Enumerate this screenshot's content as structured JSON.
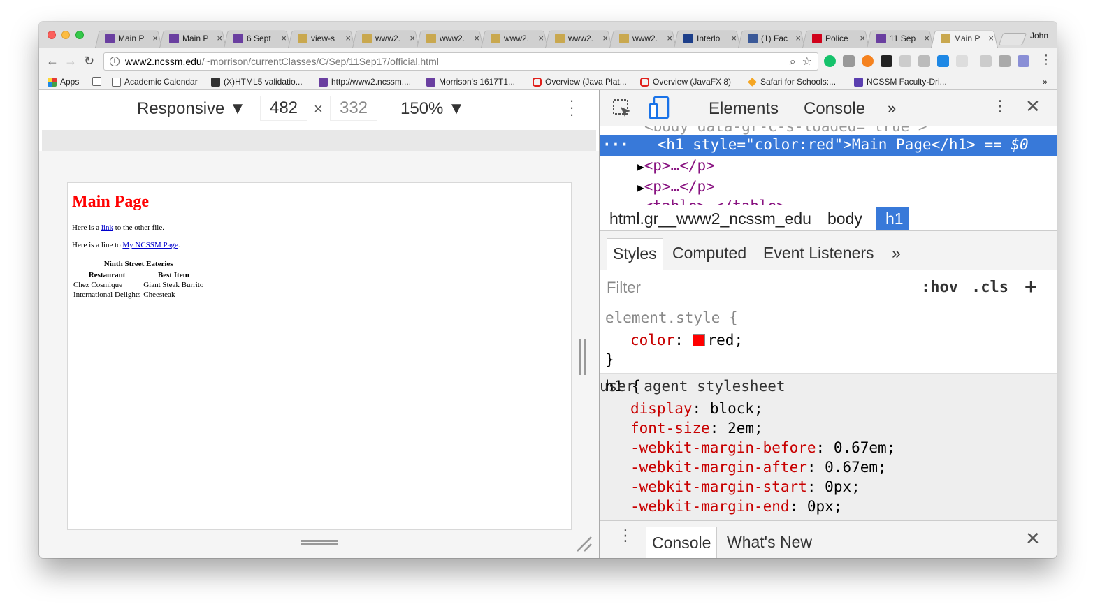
{
  "browser": {
    "tabs": [
      {
        "title": "Main P",
        "fav": "#6a3fa0",
        "active": false
      },
      {
        "title": "Main P",
        "fav": "#6a3fa0",
        "active": false
      },
      {
        "title": "6 Sept",
        "fav": "#6a3fa0",
        "active": false
      },
      {
        "title": "view-s",
        "fav": "#c9a84f",
        "active": false
      },
      {
        "title": "www2.",
        "fav": "#c9a84f",
        "active": false
      },
      {
        "title": "www2.",
        "fav": "#c9a84f",
        "active": false
      },
      {
        "title": "www2.",
        "fav": "#c9a84f",
        "active": false
      },
      {
        "title": "www2.",
        "fav": "#c9a84f",
        "active": false
      },
      {
        "title": "www2.",
        "fav": "#c9a84f",
        "active": false
      },
      {
        "title": "Interlo",
        "fav": "#1d3f8a",
        "active": false
      },
      {
        "title": "(1) Fac",
        "fav": "#3b5998",
        "active": false
      },
      {
        "title": "Police",
        "fav": "#d0021b",
        "active": false
      },
      {
        "title": "11 Sep",
        "fav": "#6a3fa0",
        "active": false
      },
      {
        "title": "Main P",
        "fav": "#c9a84f",
        "active": true
      }
    ],
    "profile_name": "John",
    "url_host": "www2.ncssm.edu",
    "url_path": "/~morrison/currentClasses/C/Sep/11Sep17/official.html",
    "bookmarks": [
      {
        "label": "Apps",
        "icon": "apps-grid-icon"
      },
      {
        "label": "",
        "icon": "page-icon"
      },
      {
        "label": "Academic Calendar",
        "icon": "page-icon"
      },
      {
        "label": "(X)HTML5 validatio...",
        "icon": "validator-icon"
      },
      {
        "label": "http://www2.ncssm....",
        "icon": "ncssm-icon"
      },
      {
        "label": "Morrison's 1617T1...",
        "icon": "ncssm-icon"
      },
      {
        "label": "Overview (Java Plat...",
        "icon": "oracle-icon"
      },
      {
        "label": "Overview (JavaFX 8)",
        "icon": "oracle-icon"
      },
      {
        "label": "Safari for Schools:...",
        "icon": "safari-icon"
      },
      {
        "label": "NCSSM Faculty-Dri...",
        "icon": "ncssm-icon"
      }
    ]
  },
  "device_toolbar": {
    "mode": "Responsive",
    "width": "482",
    "height": "332",
    "zoom": "150%",
    "separator": "×"
  },
  "page": {
    "heading": "Main Page",
    "p1_before": "Here is a ",
    "p1_link": "link",
    "p1_after": " to the other file.",
    "p2_before": "Here is a line to ",
    "p2_link": "My NCSSM Page",
    "p2_after": ".",
    "table_caption": "Ninth Street Eateries",
    "table_headers": [
      "Restaurant",
      "Best Item"
    ],
    "table_rows": [
      [
        "Chez Cosmique",
        "Giant Steak Burrito"
      ],
      [
        "International Delights",
        "Cheesteak"
      ]
    ]
  },
  "devtools": {
    "tabs": [
      "Elements",
      "Console"
    ],
    "more": "»",
    "dom_partial_top": "<body data-gr-c-s-loaded=\"true\">",
    "dom_selected_tag": "h1",
    "dom_selected_attr": "style",
    "dom_selected_val": "color:red",
    "dom_selected_text": "Main Page",
    "dom_selected_suffix": " == $0",
    "dom_children": [
      "<p>…</p>",
      "<p>…</p>",
      "<table>…</table>"
    ],
    "breadcrumbs": [
      "html.gr__www2_ncssm_edu",
      "body",
      "h1"
    ],
    "subtabs": [
      "Styles",
      "Computed",
      "Event Listeners"
    ],
    "filter_placeholder": "Filter",
    "filter_hov": ":hov",
    "filter_cls": ".cls",
    "element_style_selector": "element.style {",
    "element_style_prop": "color",
    "element_style_val": "red;",
    "close_brace": "}",
    "ua_selector": "h1 {",
    "ua_label": "user agent stylesheet",
    "ua_props": [
      {
        "prop": "display",
        "val": "block;"
      },
      {
        "prop": "font-size",
        "val": "2em;"
      },
      {
        "prop": "-webkit-margin-before",
        "val": "0.67em;"
      },
      {
        "prop": "-webkit-margin-after",
        "val": "0.67em;"
      },
      {
        "prop": "-webkit-margin-start",
        "val": "0px;"
      },
      {
        "prop": "-webkit-margin-end",
        "val": "0px;"
      }
    ],
    "drawer_tabs": [
      "Console",
      "What's New"
    ]
  }
}
